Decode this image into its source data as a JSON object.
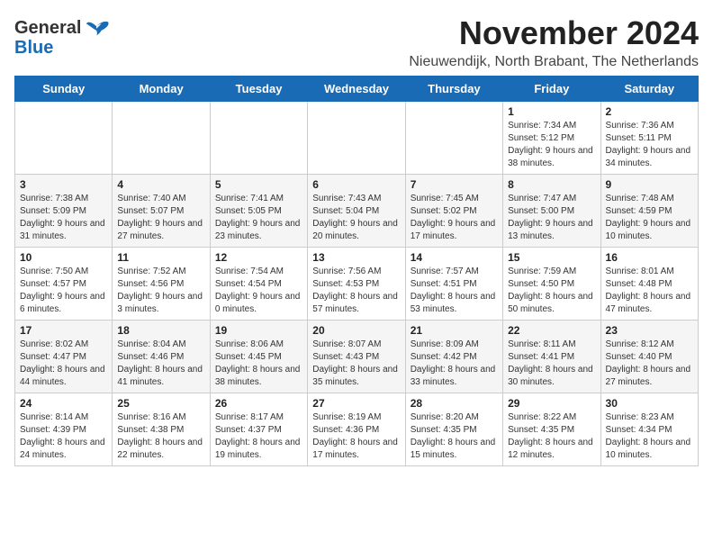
{
  "header": {
    "logo_general": "General",
    "logo_blue": "Blue",
    "month_year": "November 2024",
    "location": "Nieuwendijk, North Brabant, The Netherlands"
  },
  "days_of_week": [
    "Sunday",
    "Monday",
    "Tuesday",
    "Wednesday",
    "Thursday",
    "Friday",
    "Saturday"
  ],
  "weeks": [
    [
      {
        "day": "",
        "info": ""
      },
      {
        "day": "",
        "info": ""
      },
      {
        "day": "",
        "info": ""
      },
      {
        "day": "",
        "info": ""
      },
      {
        "day": "",
        "info": ""
      },
      {
        "day": "1",
        "info": "Sunrise: 7:34 AM\nSunset: 5:12 PM\nDaylight: 9 hours and 38 minutes."
      },
      {
        "day": "2",
        "info": "Sunrise: 7:36 AM\nSunset: 5:11 PM\nDaylight: 9 hours and 34 minutes."
      }
    ],
    [
      {
        "day": "3",
        "info": "Sunrise: 7:38 AM\nSunset: 5:09 PM\nDaylight: 9 hours and 31 minutes."
      },
      {
        "day": "4",
        "info": "Sunrise: 7:40 AM\nSunset: 5:07 PM\nDaylight: 9 hours and 27 minutes."
      },
      {
        "day": "5",
        "info": "Sunrise: 7:41 AM\nSunset: 5:05 PM\nDaylight: 9 hours and 23 minutes."
      },
      {
        "day": "6",
        "info": "Sunrise: 7:43 AM\nSunset: 5:04 PM\nDaylight: 9 hours and 20 minutes."
      },
      {
        "day": "7",
        "info": "Sunrise: 7:45 AM\nSunset: 5:02 PM\nDaylight: 9 hours and 17 minutes."
      },
      {
        "day": "8",
        "info": "Sunrise: 7:47 AM\nSunset: 5:00 PM\nDaylight: 9 hours and 13 minutes."
      },
      {
        "day": "9",
        "info": "Sunrise: 7:48 AM\nSunset: 4:59 PM\nDaylight: 9 hours and 10 minutes."
      }
    ],
    [
      {
        "day": "10",
        "info": "Sunrise: 7:50 AM\nSunset: 4:57 PM\nDaylight: 9 hours and 6 minutes."
      },
      {
        "day": "11",
        "info": "Sunrise: 7:52 AM\nSunset: 4:56 PM\nDaylight: 9 hours and 3 minutes."
      },
      {
        "day": "12",
        "info": "Sunrise: 7:54 AM\nSunset: 4:54 PM\nDaylight: 9 hours and 0 minutes."
      },
      {
        "day": "13",
        "info": "Sunrise: 7:56 AM\nSunset: 4:53 PM\nDaylight: 8 hours and 57 minutes."
      },
      {
        "day": "14",
        "info": "Sunrise: 7:57 AM\nSunset: 4:51 PM\nDaylight: 8 hours and 53 minutes."
      },
      {
        "day": "15",
        "info": "Sunrise: 7:59 AM\nSunset: 4:50 PM\nDaylight: 8 hours and 50 minutes."
      },
      {
        "day": "16",
        "info": "Sunrise: 8:01 AM\nSunset: 4:48 PM\nDaylight: 8 hours and 47 minutes."
      }
    ],
    [
      {
        "day": "17",
        "info": "Sunrise: 8:02 AM\nSunset: 4:47 PM\nDaylight: 8 hours and 44 minutes."
      },
      {
        "day": "18",
        "info": "Sunrise: 8:04 AM\nSunset: 4:46 PM\nDaylight: 8 hours and 41 minutes."
      },
      {
        "day": "19",
        "info": "Sunrise: 8:06 AM\nSunset: 4:45 PM\nDaylight: 8 hours and 38 minutes."
      },
      {
        "day": "20",
        "info": "Sunrise: 8:07 AM\nSunset: 4:43 PM\nDaylight: 8 hours and 35 minutes."
      },
      {
        "day": "21",
        "info": "Sunrise: 8:09 AM\nSunset: 4:42 PM\nDaylight: 8 hours and 33 minutes."
      },
      {
        "day": "22",
        "info": "Sunrise: 8:11 AM\nSunset: 4:41 PM\nDaylight: 8 hours and 30 minutes."
      },
      {
        "day": "23",
        "info": "Sunrise: 8:12 AM\nSunset: 4:40 PM\nDaylight: 8 hours and 27 minutes."
      }
    ],
    [
      {
        "day": "24",
        "info": "Sunrise: 8:14 AM\nSunset: 4:39 PM\nDaylight: 8 hours and 24 minutes."
      },
      {
        "day": "25",
        "info": "Sunrise: 8:16 AM\nSunset: 4:38 PM\nDaylight: 8 hours and 22 minutes."
      },
      {
        "day": "26",
        "info": "Sunrise: 8:17 AM\nSunset: 4:37 PM\nDaylight: 8 hours and 19 minutes."
      },
      {
        "day": "27",
        "info": "Sunrise: 8:19 AM\nSunset: 4:36 PM\nDaylight: 8 hours and 17 minutes."
      },
      {
        "day": "28",
        "info": "Sunrise: 8:20 AM\nSunset: 4:35 PM\nDaylight: 8 hours and 15 minutes."
      },
      {
        "day": "29",
        "info": "Sunrise: 8:22 AM\nSunset: 4:35 PM\nDaylight: 8 hours and 12 minutes."
      },
      {
        "day": "30",
        "info": "Sunrise: 8:23 AM\nSunset: 4:34 PM\nDaylight: 8 hours and 10 minutes."
      }
    ]
  ]
}
